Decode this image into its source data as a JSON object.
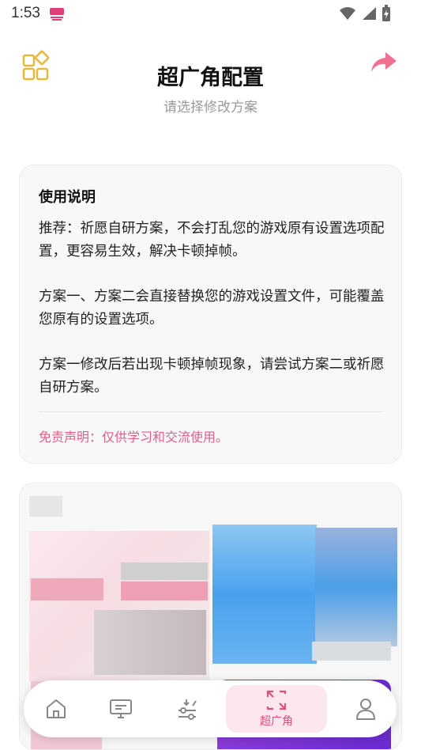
{
  "status_bar": {
    "time": "1:53",
    "notification_icon": "app-notification-icon",
    "wifi_icon": "wifi-icon",
    "signal_icon": "signal-icon",
    "battery_icon": "battery-charging-icon"
  },
  "header": {
    "title": "超广角配置",
    "subtitle": "请选择修改方案",
    "left_icon": "grid-menu-icon",
    "right_icon": "share-icon"
  },
  "instructions": {
    "heading": "使用说明",
    "paragraph1": "推荐：祈愿自研方案，不会打乱您的游戏原有设置选项配置，更容易生效，解决卡顿掉帧。",
    "paragraph2": "方案一、方案二会直接替换您的游戏设置文件，可能覆盖您原有的设置选项。",
    "paragraph3": "方案一修改后若出现卡顿掉帧现象，请尝试方案二或祈愿自研方案。",
    "disclaimer": "免责声明：仅供学习和交流使用。"
  },
  "bottom_nav": {
    "items": [
      {
        "icon": "home-icon",
        "label": ""
      },
      {
        "icon": "monitor-icon",
        "label": ""
      },
      {
        "icon": "sliders-icon",
        "label": ""
      },
      {
        "icon": "wide-angle-icon",
        "label": "超广角",
        "active": true
      },
      {
        "icon": "user-icon",
        "label": ""
      }
    ]
  },
  "colors": {
    "accent": "#e0507a",
    "icon_gold": "#e8b83a",
    "share_pink": "#f07090"
  }
}
